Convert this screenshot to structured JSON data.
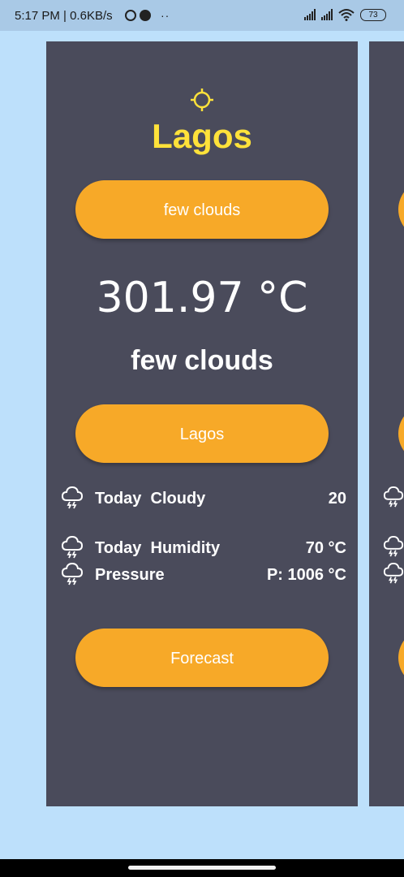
{
  "status_bar": {
    "time_speed": "5:17 PM | 0.6KB/s",
    "more": "··",
    "battery": "73"
  },
  "card": {
    "city_title": "Lagos",
    "top_button_label": "few clouds",
    "temperature": "301.97 °C",
    "condition": "few clouds",
    "city_button_label": "Lagos",
    "rows": [
      {
        "label": "Today  Cloudy",
        "value": "20",
        "icon": "cloud-lightning-icon"
      },
      {
        "label": "Today  Humidity",
        "value": "70 °C",
        "icon": "cloud-lightning-icon"
      },
      {
        "label": "Pressure",
        "value": "P: 1006 °C",
        "icon": "cloud-lightning-icon"
      }
    ],
    "forecast_button_label": "Forecast"
  },
  "colors": {
    "background": "#bde0fb",
    "card": "#4a4b5b",
    "accent": "#f7a928",
    "title": "#ffe23a"
  }
}
